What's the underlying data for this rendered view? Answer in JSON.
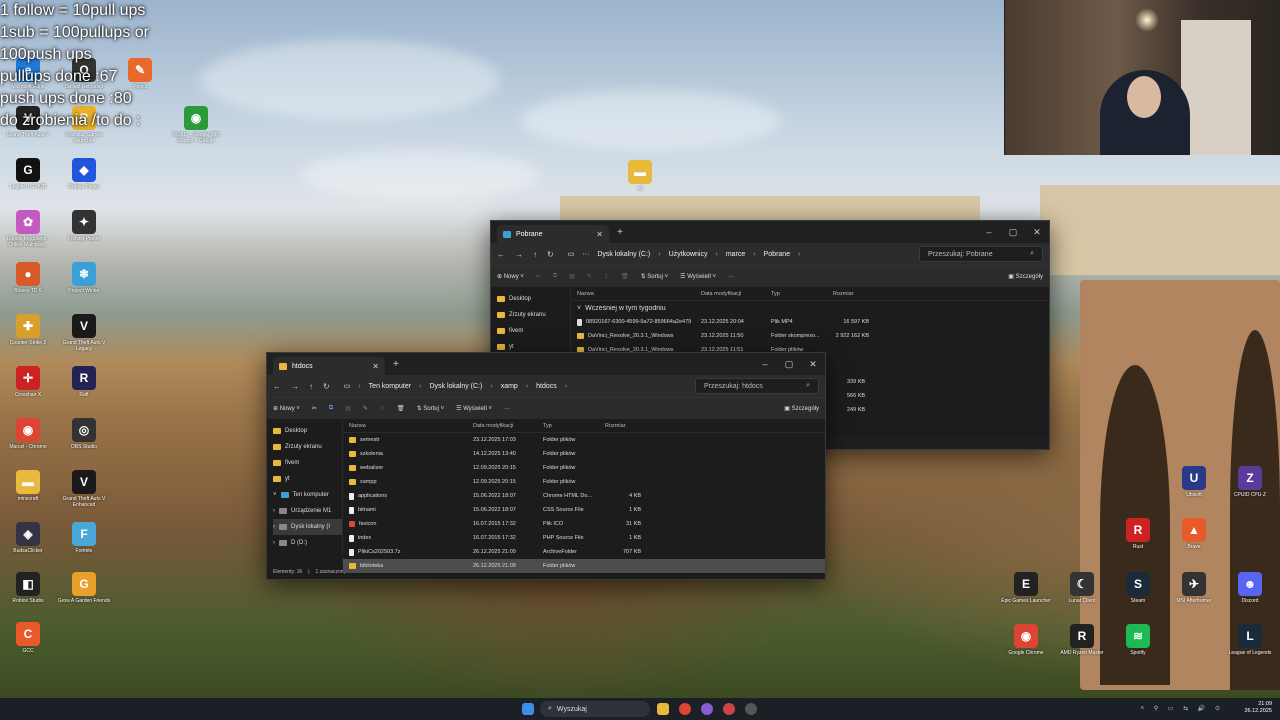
{
  "overlay": {
    "lines": [
      "1 follow = 10pull ups",
      "1sub = 100pullups or",
      "100push ups",
      "pullups done :67",
      "push ups done :80",
      "do zrobienia /to do :"
    ]
  },
  "desktop_icons": [
    {
      "label": "Microsoft Edge",
      "color": "#1f7ad6",
      "glyph": "e"
    },
    {
      "label": "Outlast Reloaded",
      "color": "#333",
      "glyph": "O"
    },
    {
      "label": "Pencil",
      "color": "#e86a2a",
      "glyph": "✎"
    },
    {
      "label": "Grand Theft Auto V",
      "color": "#222",
      "glyph": "V"
    },
    {
      "label": "Rockstar Games Launcher",
      "color": "#e8b02a",
      "glyph": "R"
    },
    {
      "label": "WSKD – Google (86) Google – Google",
      "color": "#2a9a3a",
      "glyph": "◉"
    },
    {
      "label": "Logitech G HUB",
      "color": "#111",
      "glyph": "G"
    },
    {
      "label": "Roblox Player",
      "color": "#2255dd",
      "glyph": "◆"
    },
    {
      "label": "Doodle Kingdoms - Online Multiplay...",
      "color": "#c45ac0",
      "glyph": "✿"
    },
    {
      "label": "Fishing Planet",
      "color": "#333",
      "glyph": "✦"
    },
    {
      "label": "Bloons TD 6",
      "color": "#d85a2a",
      "glyph": "●"
    },
    {
      "label": "Project Winter",
      "color": "#3aa0d8",
      "glyph": "❄"
    },
    {
      "label": "Counter-Strike 2",
      "color": "#d8a02a",
      "glyph": "✚"
    },
    {
      "label": "Grand Theft Auto V Legacy",
      "color": "#1a1a1a",
      "glyph": "V"
    },
    {
      "label": "Crosshair X",
      "color": "#c22",
      "glyph": "✛"
    },
    {
      "label": "Raft",
      "color": "#225",
      "glyph": "R"
    },
    {
      "label": "Marcel - Chrome",
      "color": "#dd4433",
      "glyph": "◉"
    },
    {
      "label": "OBS Studio",
      "color": "#333",
      "glyph": "◎"
    },
    {
      "label": "minecraft",
      "color": "#e8b93c",
      "glyph": "▬"
    },
    {
      "label": "Grand Theft Auto V Enhanced",
      "color": "#1a1a1a",
      "glyph": "V"
    },
    {
      "label": "BudsaClicker",
      "color": "#334",
      "glyph": "◈"
    },
    {
      "label": "Fortnite",
      "color": "#4aa8d8",
      "glyph": "F"
    },
    {
      "label": "Roblox Studio",
      "color": "#222",
      "glyph": "◧"
    },
    {
      "label": "Grow A Garden Friends",
      "color": "#e8a02a",
      "glyph": "G"
    },
    {
      "label": "GCC",
      "color": "#e85a2a",
      "glyph": "C"
    },
    {
      "label": "Ubisoft",
      "color": "#2a3a8a",
      "glyph": "U"
    },
    {
      "label": "CPUID CPU-Z",
      "color": "#5a3a9a",
      "glyph": "Z"
    },
    {
      "label": "Rust",
      "color": "#c22",
      "glyph": "R"
    },
    {
      "label": "Brave",
      "color": "#e85a2a",
      "glyph": "▲"
    },
    {
      "label": "Epic Games Launcher",
      "color": "#222",
      "glyph": "E"
    },
    {
      "label": "Lunar Client",
      "color": "#333",
      "glyph": "☾"
    },
    {
      "label": "Steam",
      "color": "#1a2a3a",
      "glyph": "S"
    },
    {
      "label": "MSI Afterburner",
      "color": "#333",
      "glyph": "✈"
    },
    {
      "label": "Discord",
      "color": "#5865f2",
      "glyph": "☻"
    },
    {
      "label": "Google Chrome",
      "color": "#dd4433",
      "glyph": "◉"
    },
    {
      "label": "AMD Ryzen Master",
      "color": "#222",
      "glyph": "R"
    },
    {
      "label": "Spotify",
      "color": "#1db954",
      "glyph": "≋"
    },
    {
      "label": "League of Legends",
      "color": "#1a2a3a",
      "glyph": "L"
    },
    {
      "label": "rd",
      "color": "#e8b93c",
      "glyph": "▬"
    }
  ],
  "win_back": {
    "tab": "Pobrane",
    "crumbs": [
      "Dysk lokalny (C:)",
      "Użytkownicy",
      "marce",
      "Pobrane"
    ],
    "search": "Przeszukaj: Pobrane",
    "toolbar": {
      "new": "Nowy",
      "sort": "Sortuj",
      "view": "Wyświetl",
      "details": "Szczegóły"
    },
    "nav": [
      "Desktop",
      "Zrzuty ekranu",
      "fivem",
      "yt"
    ],
    "headers": [
      "Nazwa",
      "Data modyfikacji",
      "Typ",
      "Rozmiar"
    ],
    "group": "Wcześniej w tym tygodniu",
    "rows": [
      {
        "name": "08920167-6300-4599-9a72-859664a2e479",
        "date": "23.12.2025 20:04",
        "type": "Plik MP4",
        "size": "16 597 KB"
      },
      {
        "name": "DaVinci_Resolve_20.3.1_Windows",
        "date": "23.12.2025 11:50",
        "type": "Folder skompreso...",
        "size": "2 922 162 KB"
      },
      {
        "name": "DaVinci_Resolve_20.3.1_Windows",
        "date": "23.12.2025 11:51",
        "type": "Folder plików",
        "size": ""
      }
    ],
    "sizes_extra": [
      "339 KB",
      "566 KB",
      "249 KB"
    ]
  },
  "win_front": {
    "tab": "htdocs",
    "crumbs": [
      "Ten komputer",
      "Dysk lokalny (C:)",
      "xamp",
      "htdocs"
    ],
    "search": "Przeszukaj: htdocs",
    "toolbar": {
      "new": "Nowy",
      "sort": "Sortuj",
      "view": "Wyświetl",
      "details": "Szczegóły"
    },
    "nav": [
      "Desktop",
      "Zrzuty ekranu",
      "fivem",
      "yt"
    ],
    "nav2": [
      "Ten komputer",
      "Urządzenie M1",
      "Dysk lokalny (I",
      "D (D:)"
    ],
    "headers": [
      "Nazwa",
      "Data modyfikacji",
      "Typ",
      "Rozmiar"
    ],
    "rows": [
      {
        "name": "semestr",
        "date": "23.12.2025 17:03",
        "type": "Folder plików",
        "size": "",
        "kind": "folder"
      },
      {
        "name": "szkolenia",
        "date": "14.12.2025 13:40",
        "type": "Folder plików",
        "size": "",
        "kind": "folder"
      },
      {
        "name": "webalizer",
        "date": "12.09.2025 20:15",
        "type": "Folder plików",
        "size": "",
        "kind": "folder"
      },
      {
        "name": "xampp",
        "date": "12.09.2025 20:15",
        "type": "Folder plików",
        "size": "",
        "kind": "folder"
      },
      {
        "name": "applications",
        "date": "15.06.2022 18:07",
        "type": "Chrome HTML Do...",
        "size": "4 KB",
        "kind": "doc"
      },
      {
        "name": "bitnami",
        "date": "15.06.2022 18:07",
        "type": "CSS Source File",
        "size": "1 KB",
        "kind": "doc"
      },
      {
        "name": "favicon",
        "date": "16.07.2015 17:32",
        "type": "Plik ICO",
        "size": "31 KB",
        "kind": "ico"
      },
      {
        "name": "index",
        "date": "16.07.2015 17:32",
        "type": "PHP Source File",
        "size": "1 KB",
        "kind": "doc"
      },
      {
        "name": "PlikiCs202503.7z",
        "date": "26.12.2025 21:09",
        "type": "ArchiveFolder",
        "size": "707 KB",
        "kind": "doc"
      },
      {
        "name": "biblioteka",
        "date": "26.12.2025 21:09",
        "type": "Folder plików",
        "size": "",
        "kind": "folder"
      }
    ],
    "status": {
      "count": "Elementy: 16",
      "selected": "1 zaznaczony element"
    }
  },
  "taskbar": {
    "search": "Wyszukaj",
    "time": "21:09",
    "date": "26.12.2025"
  }
}
